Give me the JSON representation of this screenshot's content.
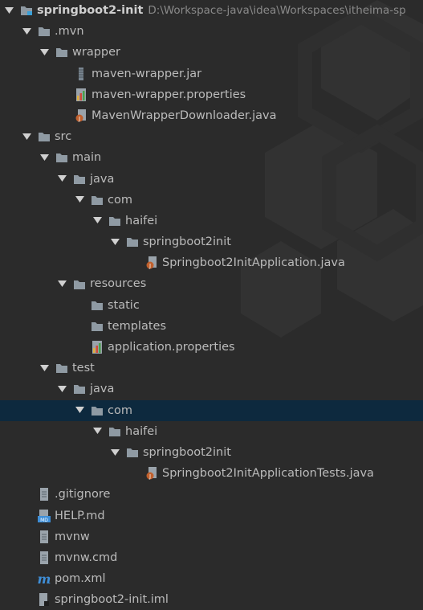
{
  "project": {
    "name": "springboot2-init",
    "path": "D:\\Workspace-java\\idea\\Workspaces\\itheima-sp"
  },
  "tree": {
    "mvn": ".mvn",
    "wrapper": "wrapper",
    "wrapper_jar": "maven-wrapper.jar",
    "wrapper_props": "maven-wrapper.properties",
    "wrapper_downloader": "MavenWrapperDownloader.java",
    "src": "src",
    "main": "main",
    "main_java": "java",
    "main_com": "com",
    "main_haifei": "haifei",
    "main_pkg": "springboot2init",
    "main_app": "Springboot2InitApplication.java",
    "resources": "resources",
    "static": "static",
    "templates": "templates",
    "app_props": "application.properties",
    "test": "test",
    "test_java": "java",
    "test_com": "com",
    "test_haifei": "haifei",
    "test_pkg": "springboot2init",
    "test_app": "Springboot2InitApplicationTests.java",
    "gitignore": ".gitignore",
    "help": "HELP.md",
    "mvnw": "mvnw",
    "mvnw_cmd": "mvnw.cmd",
    "pom": "pom.xml",
    "iml": "springboot2-init.iml"
  },
  "selected_item": "com",
  "colors": {
    "background": "#2b2b2b",
    "selection": "#0d293e",
    "folder": "#8f9aa3",
    "java_badge": "#c0602d",
    "maven_blue": "#3f8fd8"
  }
}
